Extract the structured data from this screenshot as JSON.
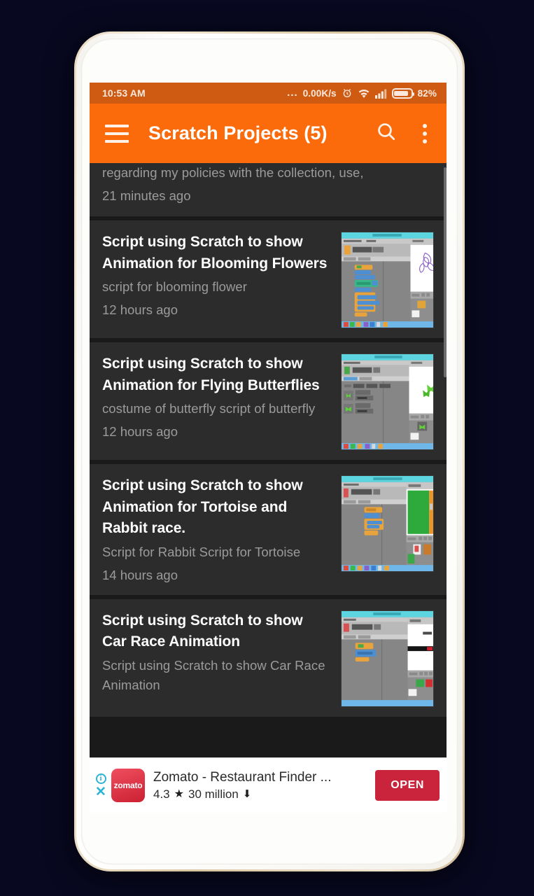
{
  "status_bar": {
    "time": "10:53 AM",
    "dots": "...",
    "network_speed": "0.00K/s",
    "alarm_icon": "alarm-icon",
    "wifi_icon": "wifi-icon",
    "signal_icon": "signal-bars-icon",
    "battery_icon": "battery-icon",
    "battery_percent": "82%"
  },
  "app_bar": {
    "menu_icon": "hamburger-menu-icon",
    "title": "Scratch Projects (5)",
    "search_icon": "search-icon",
    "overflow_icon": "more-vertical-icon"
  },
  "list": {
    "partial_item": {
      "desc": "regarding my policies with the collection, use,",
      "time": "21 minutes ago"
    },
    "items": [
      {
        "title": "Script using Scratch to show Animation for Blooming Flowers",
        "desc": "script for blooming flower",
        "time": "12 hours ago",
        "thumbnail": "scratch-blooming-flowers-thumbnail"
      },
      {
        "title": "Script using Scratch to show Animation for Flying Butterflies",
        "desc": "costume of butterfly script of butterfly",
        "time": "12 hours ago",
        "thumbnail": "scratch-flying-butterflies-thumbnail"
      },
      {
        "title": "Script using Scratch to show Animation for Tortoise and Rabbit race.",
        "desc": "Script for Rabbit  Script for Tortoise",
        "time": "14 hours ago",
        "thumbnail": "scratch-tortoise-rabbit-thumbnail"
      },
      {
        "title": "Script using Scratch to show Car Race Animation",
        "desc": "Script using Scratch to show Car Race Animation",
        "time": "",
        "thumbnail": "scratch-car-race-thumbnail"
      }
    ]
  },
  "ad": {
    "info_icon": "ad-info-icon",
    "close_icon": "ad-close-icon",
    "app_icon_label": "zomato",
    "title": "Zomato - Restaurant Finder ...",
    "rating": "4.3",
    "star_glyph": "★",
    "installs": "30 million",
    "download_glyph": "⬇",
    "cta_label": "OPEN"
  },
  "colors": {
    "page_background": "#080820",
    "status_bar": "#cf5b13",
    "app_bar_accent": "#fb6a0b",
    "card_background": "#2c2c2c",
    "list_background": "#1a1a1a",
    "title_text": "#ffffff",
    "secondary_text": "#9b9b9b",
    "ad_cta": "#c9243b",
    "ad_accent": "#2bb3d9"
  }
}
